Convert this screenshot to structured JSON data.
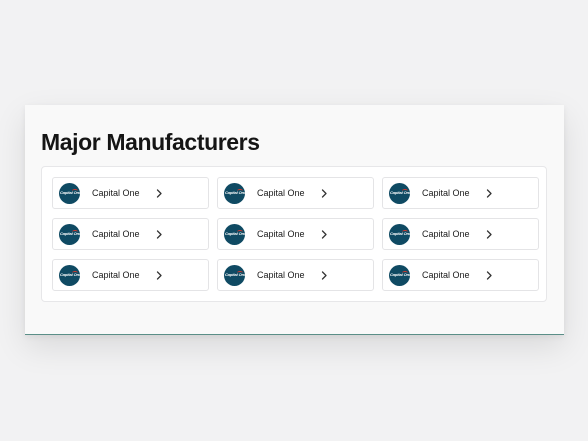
{
  "section": {
    "title": "Major Manufacturers"
  },
  "manufacturers": [
    {
      "name": "Capital One",
      "logo_text": "Capital One"
    },
    {
      "name": "Capital One",
      "logo_text": "Capital One"
    },
    {
      "name": "Capital One",
      "logo_text": "Capital One"
    },
    {
      "name": "Capital One",
      "logo_text": "Capital One"
    },
    {
      "name": "Capital One",
      "logo_text": "Capital One"
    },
    {
      "name": "Capital One",
      "logo_text": "Capital One"
    },
    {
      "name": "Capital One",
      "logo_text": "Capital One"
    },
    {
      "name": "Capital One",
      "logo_text": "Capital One"
    },
    {
      "name": "Capital One",
      "logo_text": "Capital One"
    }
  ],
  "icons": {
    "tile_arrow": "chevron-right-icon"
  },
  "colors": {
    "logo_background": "#0f4a63",
    "logo_accent": "#d03a2f",
    "title_text": "#151515",
    "tile_border": "#e4e4e6"
  }
}
